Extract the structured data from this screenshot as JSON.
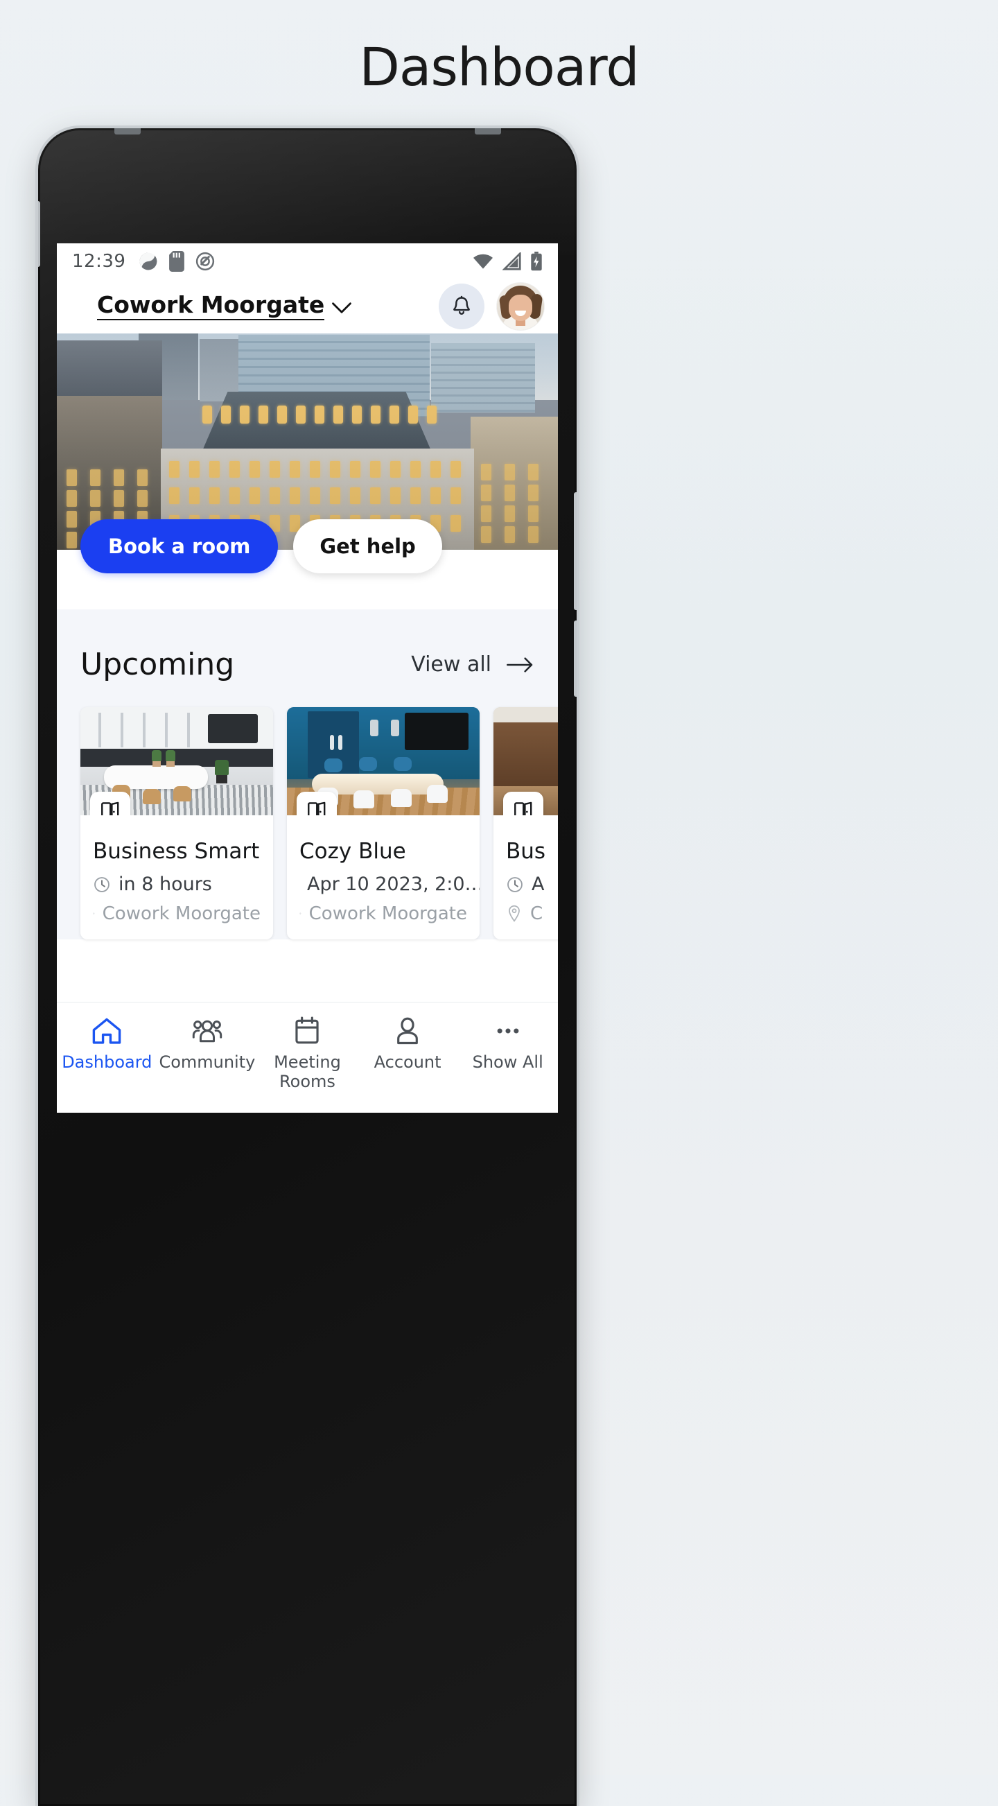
{
  "page": {
    "title": "Dashboard"
  },
  "status_bar": {
    "time": "12:39",
    "left_icons": [
      "app-sync-icon",
      "sd-card-icon",
      "android-q-icon"
    ],
    "right_icons": [
      "wifi-icon",
      "cellular-signal-icon",
      "battery-charging-icon"
    ]
  },
  "app_header": {
    "location_name": "Cowork Moorgate",
    "location_chevron": "chevron-down-icon",
    "notifications_icon": "bell-icon",
    "avatar": "user-avatar"
  },
  "hero": {
    "image_alt": "office-building-exterior",
    "primary_button": "Book a room",
    "secondary_button": "Get help"
  },
  "upcoming": {
    "title": "Upcoming",
    "view_all_label": "View all",
    "view_all_icon": "arrow-right-icon",
    "cards": [
      {
        "name": "Business Smart",
        "time": "in 8 hours",
        "location": "Cowork Moorgate",
        "badge_icon": "meeting-room-door-icon",
        "clock_icon": "clock-icon",
        "pin_icon": "map-pin-icon"
      },
      {
        "name": "Cozy Blue",
        "time": "Apr 10 2023, 2:0…",
        "location": "Cowork Moorgate",
        "badge_icon": "meeting-room-door-icon",
        "clock_icon": "clock-icon",
        "pin_icon": "map-pin-icon"
      },
      {
        "name": "Bus",
        "time": "A",
        "location": "C",
        "badge_icon": "meeting-room-door-icon",
        "clock_icon": "clock-icon",
        "pin_icon": "map-pin-icon"
      }
    ]
  },
  "bottom_nav": {
    "items": [
      {
        "label": "Dashboard",
        "icon": "home-icon",
        "active": true
      },
      {
        "label": "Community",
        "icon": "people-group-icon",
        "active": false
      },
      {
        "label": "Meeting\nRooms",
        "icon": "calendar-icon",
        "active": false
      },
      {
        "label": "Account",
        "icon": "person-icon",
        "active": false
      },
      {
        "label": "Show All",
        "icon": "ellipsis-icon",
        "active": false
      }
    ]
  },
  "colors": {
    "accent_blue": "#1b3ff1",
    "nav_active": "#1b55f1",
    "section_bg": "#f4f6fa",
    "page_bg": "#edf1f4"
  }
}
